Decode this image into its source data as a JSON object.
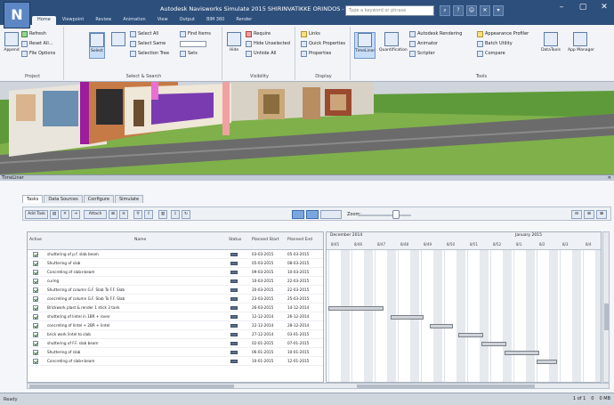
{
  "window": {
    "title": "Autodesk Navisworks Simulate 2015 SHIRINVATIKKE ORINDOS - vs web.nwf",
    "search_placeholder": "Type a keyword or phrase",
    "logo": "N"
  },
  "tabs": [
    "Home",
    "Viewpoint",
    "Review",
    "Animation",
    "View",
    "Output",
    "BIM 360",
    "Render"
  ],
  "ribbon": {
    "project": {
      "label": "Project",
      "append": "Append",
      "refresh": "Refresh",
      "reset_all": "Reset All...",
      "file_options": "File Options"
    },
    "select": {
      "label": "Select & Search",
      "select": "Select",
      "select_all": "Select All",
      "select_same": "Select Same",
      "selection_tree": "Selection Tree",
      "find_items": "Find Items",
      "quick_find": "Quick Find",
      "sets": "Sets"
    },
    "visibility": {
      "label": "Visibility",
      "hide": "Hide",
      "require": "Require",
      "hide_unselected": "Hide Unselected",
      "unhide_all": "Unhide All"
    },
    "display": {
      "label": "Display",
      "links": "Links",
      "quick_properties": "Quick Properties",
      "properties": "Properties"
    },
    "tools": {
      "label": "Tools",
      "timeliner": "TimeLiner",
      "quantification": "Quantification",
      "autodesk_rendering": "Autodesk Rendering",
      "animator": "Animator",
      "scripter": "Scripter",
      "appearance_profiler": "Appearance Profiler",
      "batch_utility": "Batch Utility",
      "compare": "Compare",
      "datatools": "DataTools",
      "app_manager": "App Manager"
    }
  },
  "timeliner": {
    "panel_title": "TimeLiner",
    "subtabs": [
      "Tasks",
      "Data Sources",
      "Configure",
      "Simulate"
    ],
    "add_task": "Add Task",
    "attach": "Attach",
    "zoom_label": "Zoom:",
    "zoom_level": 0.72,
    "columns": [
      "Active",
      "Name",
      "Status",
      "Planned Start",
      "Planned End"
    ],
    "tasks": [
      {
        "name": "shuttering of p.f. slab beam",
        "start": "03-03-2015",
        "end": "05-03-2015",
        "active": true
      },
      {
        "name": "Shuttering of slab",
        "start": "05-03-2015",
        "end": "08-03-2015",
        "active": true
      },
      {
        "name": "Concreting of slab+beam",
        "start": "09-03-2015",
        "end": "10-03-2015",
        "active": true
      },
      {
        "name": "curing",
        "start": "10-03-2015",
        "end": "22-03-2015",
        "active": true
      },
      {
        "name": "Shuttering of column G.F. Slab To F.F. Slab",
        "start": "20-03-2015",
        "end": "22-03-2015",
        "active": true
      },
      {
        "name": "concreting of column G.F. Slab To F.F. Slab",
        "start": "23-03-2015",
        "end": "25-03-2015",
        "active": true
      },
      {
        "name": "Brickwork plast & render 1 stick 3 tank",
        "start": "26-03-2015",
        "end": "14-12-2014",
        "active": true
      },
      {
        "name": "shuttering of lintel in 1BR + rover",
        "start": "12-12-2014",
        "end": "26-12-2014",
        "active": true
      },
      {
        "name": "concreting of lintel + 2BR + lintel",
        "start": "22-12-2014",
        "end": "28-12-2014",
        "active": true
      },
      {
        "name": "brick work lintel to slab",
        "start": "27-12-2014",
        "end": "03-01-2015",
        "active": true
      },
      {
        "name": "shuttering of F.F. slab beam",
        "start": "02-01-2015",
        "end": "07-01-2015",
        "active": true
      },
      {
        "name": "Shuttering of slab",
        "start": "06-01-2015",
        "end": "10-01-2015",
        "active": true
      },
      {
        "name": "Concreting of slab+beam",
        "start": "10-01-2015",
        "end": "12-01-2015",
        "active": true
      }
    ],
    "gantt": {
      "months": [
        "December 2014",
        "January 2015"
      ],
      "days": [
        "8/45",
        "8/46",
        "8/47",
        "8/48",
        "8/49",
        "8/50",
        "8/51",
        "8/52",
        "8/1",
        "8/2",
        "8/3",
        "8/4"
      ],
      "bars": [
        {
          "row": 6,
          "start_day": 0,
          "len_days": 2.4
        },
        {
          "row": 7,
          "start_day": 2.7,
          "len_days": 1.4
        },
        {
          "row": 8,
          "start_day": 4.4,
          "len_days": 1.0
        },
        {
          "row": 9,
          "start_day": 5.6,
          "len_days": 1.1
        },
        {
          "row": 10,
          "start_day": 6.6,
          "len_days": 1.1
        },
        {
          "row": 11,
          "start_day": 7.6,
          "len_days": 1.5
        },
        {
          "row": 12,
          "start_day": 9.0,
          "len_days": 0.9
        }
      ]
    }
  },
  "status_bar": {
    "left": "Ready",
    "right": [
      "1 of 1",
      "0",
      "0 MB"
    ]
  }
}
